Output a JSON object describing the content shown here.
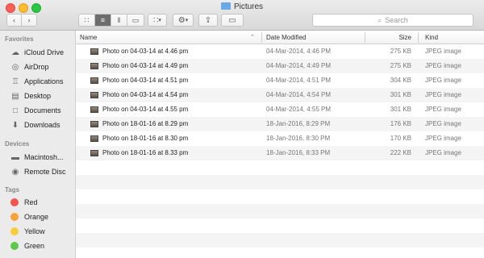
{
  "window": {
    "title": "Pictures"
  },
  "toolbar": {
    "search_placeholder": "Search"
  },
  "sidebar": {
    "favorites_label": "Favorites",
    "favorites": [
      {
        "label": "iCloud Drive",
        "icon": "cloud-icon"
      },
      {
        "label": "AirDrop",
        "icon": "airdrop-icon"
      },
      {
        "label": "Applications",
        "icon": "applications-icon"
      },
      {
        "label": "Desktop",
        "icon": "desktop-icon"
      },
      {
        "label": "Documents",
        "icon": "documents-icon"
      },
      {
        "label": "Downloads",
        "icon": "downloads-icon"
      }
    ],
    "devices_label": "Devices",
    "devices": [
      {
        "label": "Macintosh...",
        "icon": "hard-drive-icon"
      },
      {
        "label": "Remote Disc",
        "icon": "disc-icon"
      }
    ],
    "tags_label": "Tags",
    "tags": [
      {
        "label": "Red",
        "color": "#f3544e"
      },
      {
        "label": "Orange",
        "color": "#f7a23a"
      },
      {
        "label": "Yellow",
        "color": "#f8cd3a"
      },
      {
        "label": "Green",
        "color": "#5dc84a"
      }
    ]
  },
  "table": {
    "columns": {
      "name": "Name",
      "date": "Date Modified",
      "size": "Size",
      "kind": "Kind"
    },
    "rows": [
      {
        "name": "Photo on 04-03-14 at 4.46 pm",
        "date": "04-Mar-2014, 4:46 PM",
        "size": "275 KB",
        "kind": "JPEG image"
      },
      {
        "name": "Photo on 04-03-14 at 4.49 pm",
        "date": "04-Mar-2014, 4:49 PM",
        "size": "275 KB",
        "kind": "JPEG image"
      },
      {
        "name": "Photo on 04-03-14 at 4.51 pm",
        "date": "04-Mar-2014, 4:51 PM",
        "size": "304 KB",
        "kind": "JPEG image"
      },
      {
        "name": "Photo on 04-03-14 at 4.54 pm",
        "date": "04-Mar-2014, 4:54 PM",
        "size": "301 KB",
        "kind": "JPEG image"
      },
      {
        "name": "Photo on 04-03-14 at 4.55 pm",
        "date": "04-Mar-2014, 4:55 PM",
        "size": "301 KB",
        "kind": "JPEG image"
      },
      {
        "name": "Photo on 18-01-16 at 8.29 pm",
        "date": "18-Jan-2016, 8:29 PM",
        "size": "176 KB",
        "kind": "JPEG image"
      },
      {
        "name": "Photo on 18-01-16 at 8.30 pm",
        "date": "18-Jan-2016, 8:30 PM",
        "size": "170 KB",
        "kind": "JPEG image"
      },
      {
        "name": "Photo on 18-01-16 at 8.33 pm",
        "date": "18-Jan-2016, 8:33 PM",
        "size": "222 KB",
        "kind": "JPEG image"
      }
    ]
  }
}
